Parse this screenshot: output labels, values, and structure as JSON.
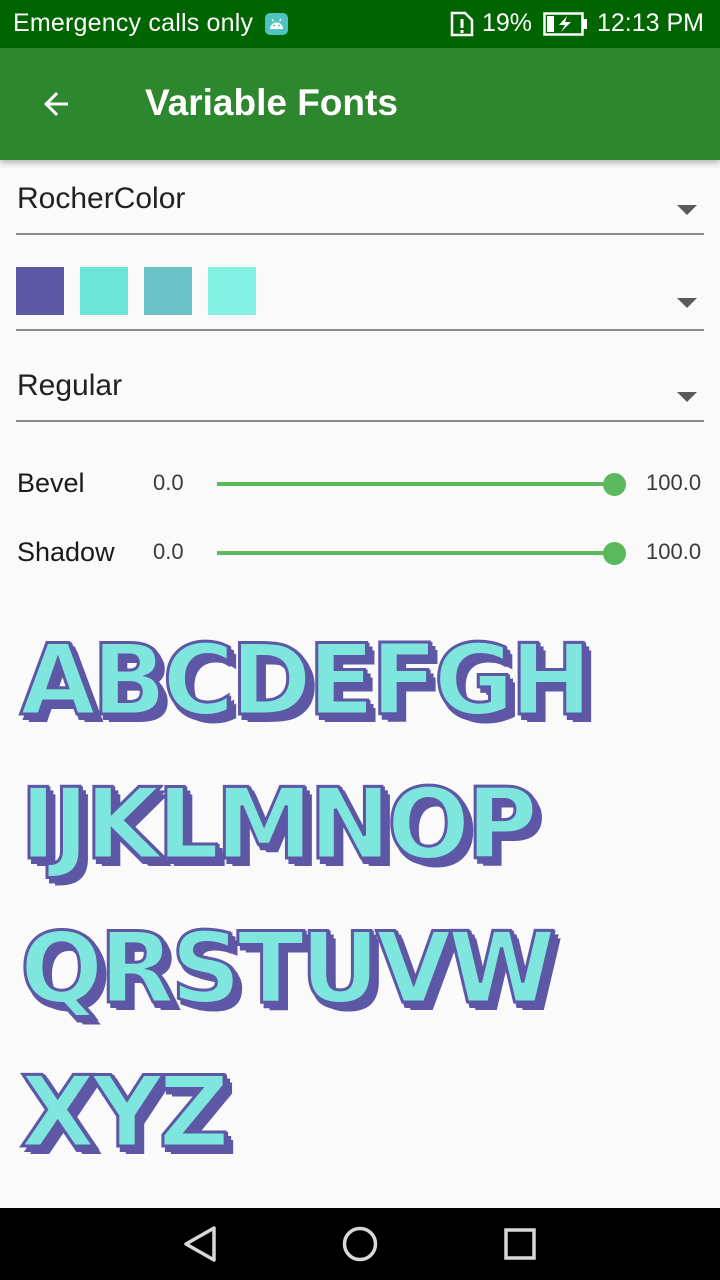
{
  "status_bar": {
    "carrier": "Emergency calls only",
    "battery_percent": "19%",
    "time": "12:13 PM",
    "icons": [
      "android-debug-icon",
      "sim-alert-icon",
      "battery-charging-icon"
    ]
  },
  "app_bar": {
    "title": "Variable Fonts",
    "back_icon": "arrow-back-icon",
    "color": "#2e862e"
  },
  "font_selector": {
    "value": "RocherColor"
  },
  "palette_selector": {
    "swatches": [
      "#5e57a6",
      "#6ae5d6",
      "#6bc3c8",
      "#84f0e2"
    ]
  },
  "style_selector": {
    "value": "Regular"
  },
  "sliders": [
    {
      "label": "Bevel",
      "min": "0.0",
      "max": "100.0",
      "value": 100
    },
    {
      "label": "Shadow",
      "min": "0.0",
      "max": "100.0",
      "value": 100
    }
  ],
  "sample": {
    "lines": [
      "ABCDEFGH",
      "IJKLMNOP",
      "QRSTUVW",
      "XYZ"
    ],
    "fill_color": "#7ee6dc",
    "outline_color": "#5e57a6"
  },
  "nav_bar": {
    "buttons": [
      "back-triangle-icon",
      "home-circle-icon",
      "recents-square-icon"
    ]
  }
}
